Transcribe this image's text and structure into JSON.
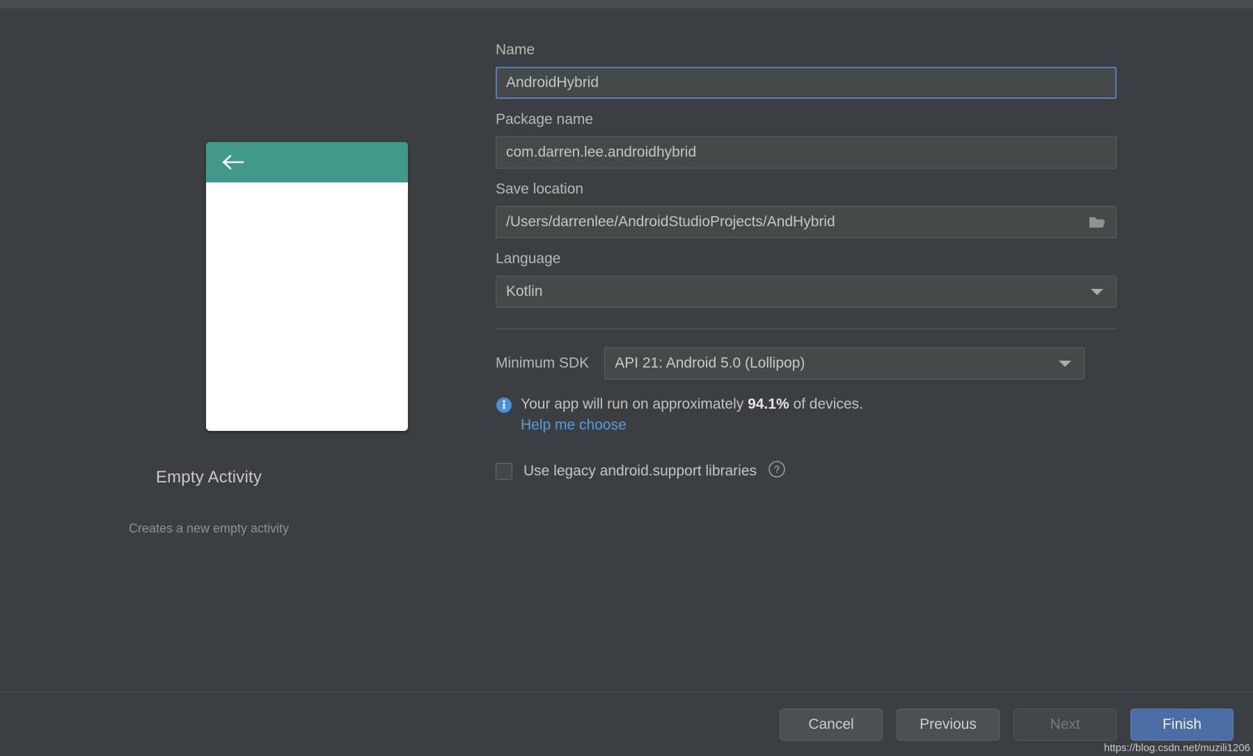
{
  "preview": {
    "back_icon": "back-arrow-icon",
    "template_title": "Empty Activity",
    "template_description": "Creates a new empty activity"
  },
  "form": {
    "name": {
      "label": "Name",
      "value": "AndroidHybrid",
      "focused": true
    },
    "package_name": {
      "label": "Package name",
      "value": "com.darren.lee.androidhybrid"
    },
    "save_location": {
      "label": "Save location",
      "value": "/Users/darrenlee/AndroidStudioProjects/AndHybrid",
      "browse_icon": "folder-icon"
    },
    "language": {
      "label": "Language",
      "value": "Kotlin",
      "caret_icon": "chevron-down-icon"
    },
    "minimum_sdk": {
      "label": "Minimum SDK",
      "value": "API 21: Android 5.0 (Lollipop)",
      "caret_icon": "chevron-down-icon"
    },
    "device_info": {
      "icon": "info-icon",
      "text_before": "Your app will run on approximately ",
      "percent": "94.1%",
      "text_after": " of devices.",
      "help_link": "Help me choose"
    },
    "legacy_checkbox": {
      "label": "Use legacy android.support libraries",
      "checked": false,
      "help_icon": "question-mark-icon"
    }
  },
  "footer": {
    "cancel": "Cancel",
    "previous": "Previous",
    "next": "Next",
    "finish": "Finish"
  },
  "watermark": "https://blog.csdn.net/muzili1206",
  "colors": {
    "background": "#3c3f41",
    "accent_teal": "#40998a",
    "accent_blue": "#4a6da5",
    "link_blue": "#5c9ae0",
    "info_blue": "#4a90d9"
  }
}
